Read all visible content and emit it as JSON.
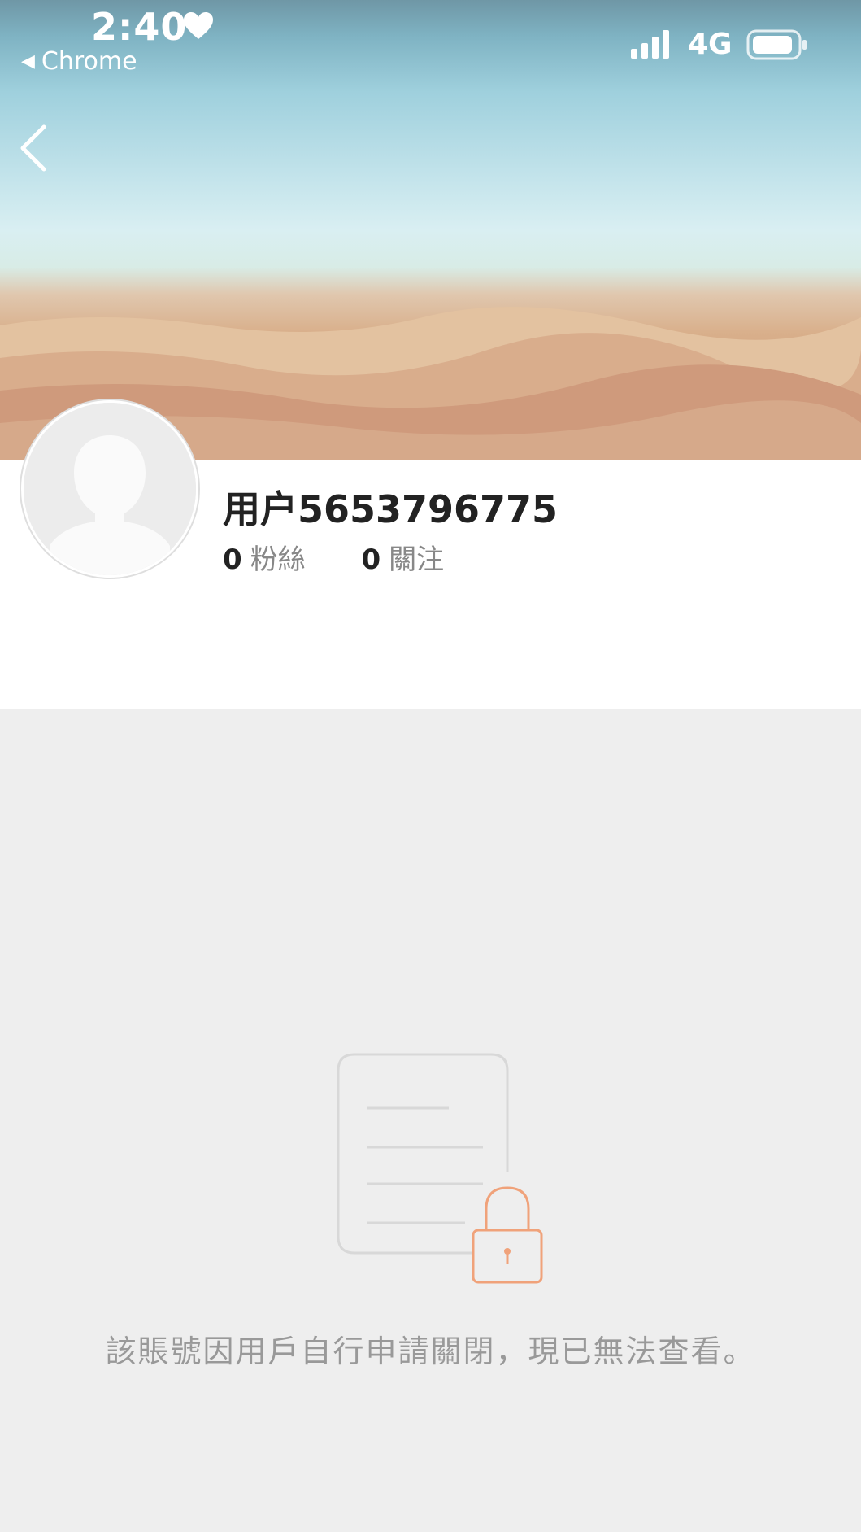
{
  "status_bar": {
    "time": "2:40",
    "back_app_label": "Chrome",
    "network": "4G"
  },
  "profile": {
    "username": "用户5653796775",
    "followers_count": "0",
    "followers_label": "粉絲",
    "following_count": "0",
    "following_label": "關注"
  },
  "empty_state": {
    "message": "該賬號因用戶自行申請關閉，現已無法查看。",
    "accent_color": "#f0a27a"
  },
  "icons": [
    "heart-icon",
    "signal-icon",
    "battery-icon",
    "back-arrow-icon",
    "avatar-placeholder-icon",
    "document-lock-icon"
  ]
}
